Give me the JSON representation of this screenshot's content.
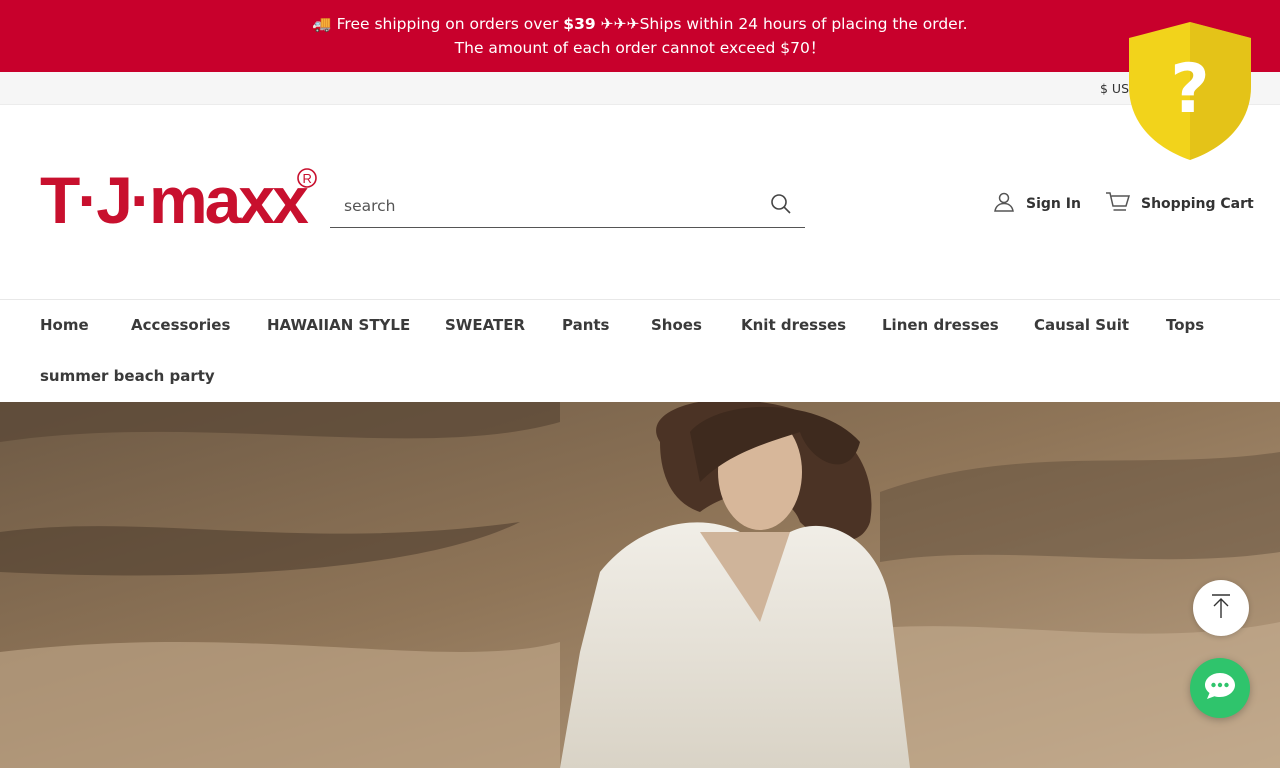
{
  "announcement": {
    "truck_icon": "delivery-truck-emoji",
    "line1_prefix": "Free shipping on orders over ",
    "line1_price": "$39",
    "line1_planes": "✈✈✈",
    "line1_suffix": "Ships within 24 hours of placing the order.",
    "line2": "The amount of each order cannot exceed $70！",
    "bg_color": "#c8002c"
  },
  "utility": {
    "currency": "$ USD"
  },
  "header": {
    "logo_text": "T·J·maxx",
    "logo_color": "#c8102e",
    "search": {
      "placeholder": "search",
      "value": "",
      "icon": "search-icon"
    },
    "account": {
      "label": "Sign In",
      "icon": "user-icon"
    },
    "cart": {
      "label": "Shopping Cart",
      "icon": "cart-icon"
    }
  },
  "nav": {
    "items": [
      "Home",
      "Accessories",
      "HAWAIIAN STYLE",
      "SWEATER",
      "Pants",
      "Shoes",
      "Knit dresses",
      "Linen dresses",
      "Causal Suit",
      "Tops",
      "summer beach party"
    ]
  },
  "hero": {
    "image": "woman in white blouse sitting on sandstone rocks"
  },
  "overlays": {
    "shield_icon": "question-shield-icon",
    "shield_color": "#f2d31b",
    "back_to_top_icon": "arrow-up-icon",
    "chat_icon": "chat-bubble-icon",
    "chat_color": "#2fc46c"
  }
}
